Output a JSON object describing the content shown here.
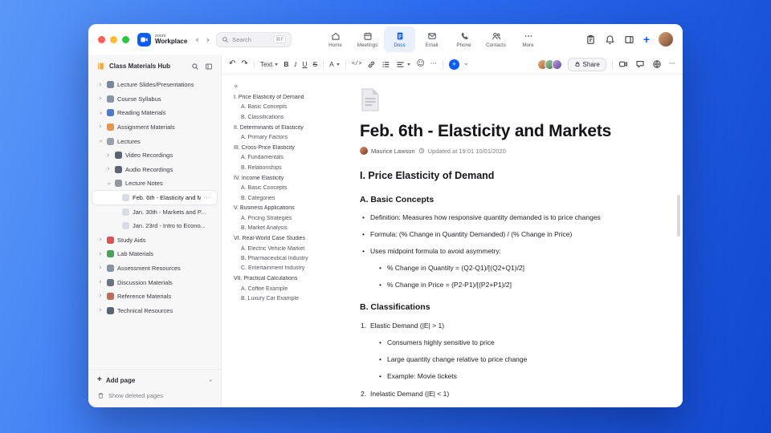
{
  "icons": {
    "back": "‹",
    "forward": "›",
    "search_shortcut": "⌘F",
    "undo": "↶",
    "redo": "↷",
    "emoji": "☺",
    "more_dots": "···",
    "plus": "+",
    "collapse_outline": "«"
  },
  "colors": {
    "accent_blue": "#0b5cff",
    "active_tab_bg": "#e9f0ff",
    "sidebar_bg": "#f7f7f8"
  },
  "titlebar": {
    "brand_top": "zoom",
    "brand_bottom": "Workplace",
    "search_placeholder": "Search",
    "tabs": [
      {
        "label": "Home"
      },
      {
        "label": "Meetings"
      },
      {
        "label": "Docs",
        "active": true
      },
      {
        "label": "Email"
      },
      {
        "label": "Phone"
      },
      {
        "label": "Contacts"
      },
      {
        "label": "More"
      }
    ]
  },
  "toolbar": {
    "text_style": "Text",
    "bold": "B",
    "italic": "I",
    "underline": "U",
    "strike": "S",
    "color": "A",
    "code": "</>",
    "share": "Share"
  },
  "sidebar": {
    "title": "Class Materials Hub",
    "tree": [
      {
        "label": "Lecture Slides/Presentations",
        "depth": 0,
        "chevron": "right",
        "icon": "slides-icon",
        "icon_color": "#7a8699"
      },
      {
        "label": "Course Syllabus",
        "depth": 0,
        "chevron": "right",
        "icon": "syllabus-icon",
        "icon_color": "#8a93a6"
      },
      {
        "label": "Reading Materials",
        "depth": 0,
        "chevron": "down",
        "icon": "book-icon",
        "icon_color": "#4a7bd0"
      },
      {
        "label": "Assignment Materials",
        "depth": 0,
        "chevron": "right",
        "icon": "folder-icon",
        "icon_color": "#e8924a"
      },
      {
        "label": "Lectures",
        "depth": 0,
        "chevron": "down",
        "icon": "tag-icon",
        "icon_color": "#9aa1ad"
      },
      {
        "label": "Video Recordings",
        "depth": 1,
        "chevron": "right",
        "icon": "video-icon",
        "icon_color": "#5b6472"
      },
      {
        "label": "Audio Recordings",
        "depth": 1,
        "chevron": "right",
        "icon": "audio-icon",
        "icon_color": "#5b6472"
      },
      {
        "label": "Lecture Notes",
        "depth": 1,
        "chevron": "down",
        "icon": "note-icon",
        "icon_color": "#8f97a3"
      },
      {
        "label": "Feb. 6th - Elasticity and M...",
        "depth": 2,
        "chevron": "none",
        "icon": "page-icon",
        "icon_color": "#d9dde3",
        "selected": true,
        "more": "···"
      },
      {
        "label": "Jan. 30th - Markets and P...",
        "depth": 2,
        "chevron": "none",
        "icon": "page-icon",
        "icon_color": "#d9dde3"
      },
      {
        "label": "Jan. 23rd - Intro to Econo...",
        "depth": 2,
        "chevron": "none",
        "icon": "page-icon",
        "icon_color": "#d9dde3"
      },
      {
        "label": "Study Aids",
        "depth": 0,
        "chevron": "right",
        "icon": "apple-icon",
        "icon_color": "#d9534f"
      },
      {
        "label": "Lab Materials",
        "depth": 0,
        "chevron": "right",
        "icon": "flask-icon",
        "icon_color": "#47a25b"
      },
      {
        "label": "Assessment Resources",
        "depth": 0,
        "chevron": "right",
        "icon": "chart-icon",
        "icon_color": "#8a93a6"
      },
      {
        "label": "Discussion Materials",
        "depth": 0,
        "chevron": "right",
        "icon": "chat-icon",
        "icon_color": "#6b7484"
      },
      {
        "label": "Reference Materials",
        "depth": 0,
        "chevron": "right",
        "icon": "books-icon",
        "icon_color": "#c06a5a"
      },
      {
        "label": "Technical Resources",
        "depth": 0,
        "chevron": "right",
        "icon": "tools-icon",
        "icon_color": "#5b6472"
      }
    ],
    "footer": {
      "add_page": "Add page",
      "show_deleted": "Show deleted pages"
    }
  },
  "outline": {
    "items": [
      {
        "label": "I. Price Elasticity of Demand",
        "level": 1
      },
      {
        "label": "A. Basic Concepts",
        "level": 2
      },
      {
        "label": "B. Classifications",
        "level": 2
      },
      {
        "label": "II. Determinants of Elasticity",
        "level": 1
      },
      {
        "label": "A. Primary Factors",
        "level": 2
      },
      {
        "label": "III. Cross-Price Elasticity",
        "level": 1
      },
      {
        "label": "A. Fundamentals",
        "level": 2
      },
      {
        "label": "B. Relationships",
        "level": 2
      },
      {
        "label": "IV. Income Elasticity",
        "level": 1
      },
      {
        "label": "A. Basic Concepts",
        "level": 2
      },
      {
        "label": "B. Categories",
        "level": 2
      },
      {
        "label": "V. Business Applications",
        "level": 1
      },
      {
        "label": "A. Pricing Strategies",
        "level": 2
      },
      {
        "label": "B. Market Analysis",
        "level": 2
      },
      {
        "label": "VI. Real-World Case Studies",
        "level": 1
      },
      {
        "label": "A. Electric Vehicle Market",
        "level": 2
      },
      {
        "label": "B. Pharmaceutical Industry",
        "level": 2
      },
      {
        "label": "C. Entertainment Industry",
        "level": 2
      },
      {
        "label": "VII. Practical Calculations",
        "level": 1
      },
      {
        "label": "A. Coffee Example",
        "level": 2
      },
      {
        "label": "B. Luxury Car Example",
        "level": 2
      }
    ]
  },
  "doc": {
    "title": "Feb. 6th - Elasticity and Markets",
    "author": "Maurice Lawson",
    "updated": "Updated at 19:01 10/01/2020",
    "h2": "I. Price Elasticity of Demand",
    "h3_a": "A. Basic Concepts",
    "a_bullets": [
      "Definition: Measures how responsive quantity demanded is to price changes",
      "Formula: (% Change in Quantity Demanded) / (% Change in Price)",
      "Uses midpoint formula to avoid asymmetry:"
    ],
    "a_sub_bullets": [
      "% Change in Quantity = (Q2-Q1)/[(Q2+Q1)/2]",
      "% Change in Price = (P2-P1)/[(P2+P1)/2]"
    ],
    "h3_b": "B. Classifications",
    "b_items": [
      {
        "num": "1.",
        "text": "Elastic Demand (|E| > 1)"
      },
      {
        "num": "2.",
        "text": "Inelastic Demand (|E| < 1)"
      }
    ],
    "b_item1_bullets": [
      "Consumers highly sensitive to price",
      "Large quantity change relative to price change",
      "Example: Movie tickets"
    ]
  }
}
